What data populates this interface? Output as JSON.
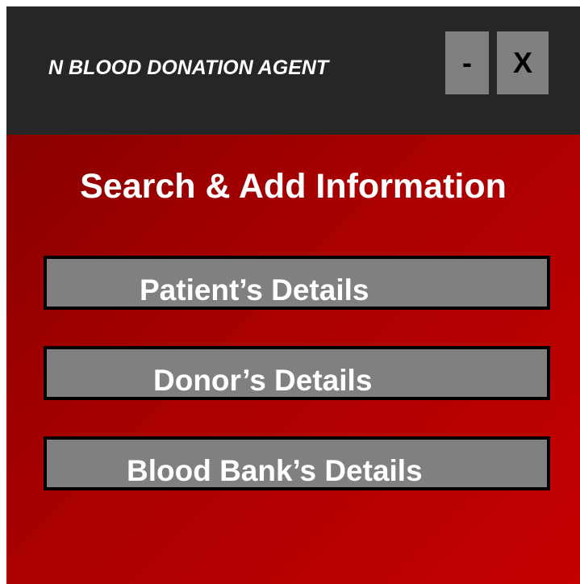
{
  "window": {
    "title": "N BLOOD DONATION AGENT",
    "minimize_label": "-",
    "close_label": "X"
  },
  "main": {
    "heading": "Search & Add Information",
    "buttons": [
      {
        "label": "Patient’s Details"
      },
      {
        "label": "Donor’s Details"
      },
      {
        "label": "Blood Bank’s Details"
      }
    ]
  },
  "colors": {
    "titlebar": "#262626",
    "content_dark": "#8a0000",
    "content_light": "#c40000",
    "button_gray": "#808080"
  }
}
